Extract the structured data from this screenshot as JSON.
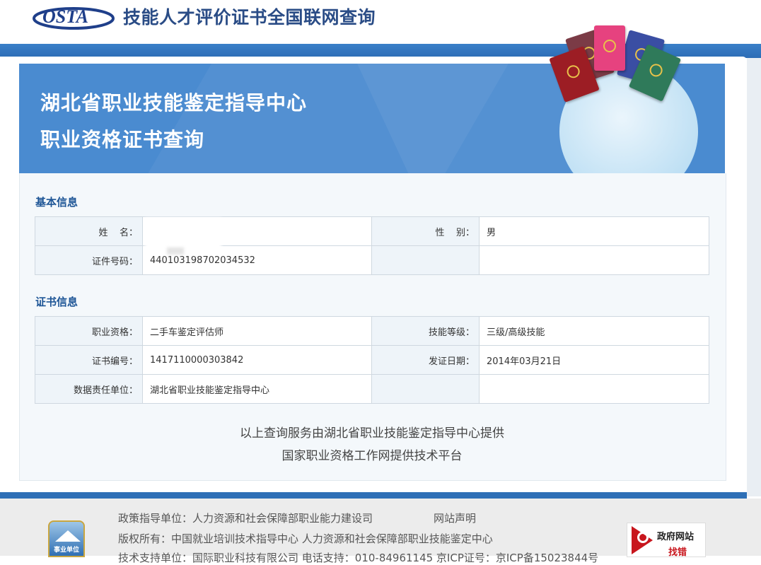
{
  "header": {
    "logo_text": "OSTA",
    "site_title": "技能人才评价证书全国联网查询"
  },
  "banner": {
    "line1": "湖北省职业技能鉴定指导中心",
    "line2": "职业资格证书查询"
  },
  "basic_info": {
    "section_title": "基本信息",
    "name_label": "姓    名：",
    "name_value": "",
    "gender_label": "性    别：",
    "gender_value": "男",
    "id_label": "证件号码：",
    "id_value": "440103198702034532"
  },
  "cert_info": {
    "section_title": "证书信息",
    "qualification_label": "职业资格：",
    "qualification_value": "二手车鉴定评估师",
    "level_label": "技能等级：",
    "level_value": "三级/高级技能",
    "cert_no_label": "证书编号：",
    "cert_no_value": "1417110000303842",
    "issue_date_label": "发证日期：",
    "issue_date_value": "2014年03月21日",
    "unit_label": "数据责任单位：",
    "unit_value": "湖北省职业技能鉴定指导中心"
  },
  "notes": {
    "line1": "以上查询服务由湖北省职业技能鉴定指导中心提供",
    "line2": "国家职业资格工作网提供技术平台"
  },
  "footer": {
    "policy": "政策指导单位：人力资源和社会保障部职业能力建设司",
    "statement": "网站声明",
    "copyright": "版权所有：中国就业培训技术指导中心  人力资源和社会保障部职业技能鉴定中心",
    "support": "技术支持单位：国际职业科技有限公司  电话支持：010-84961145  京ICP证号：京ICP备15023844号",
    "badge_text": "事业单位",
    "gov_line1": "政府网站",
    "gov_line2": "找错"
  },
  "colors": {
    "brand_blue": "#2a4c86",
    "banner_blue": "#4a8bd0",
    "section_blue": "#1d5596",
    "gov_red": "#c8161d"
  }
}
